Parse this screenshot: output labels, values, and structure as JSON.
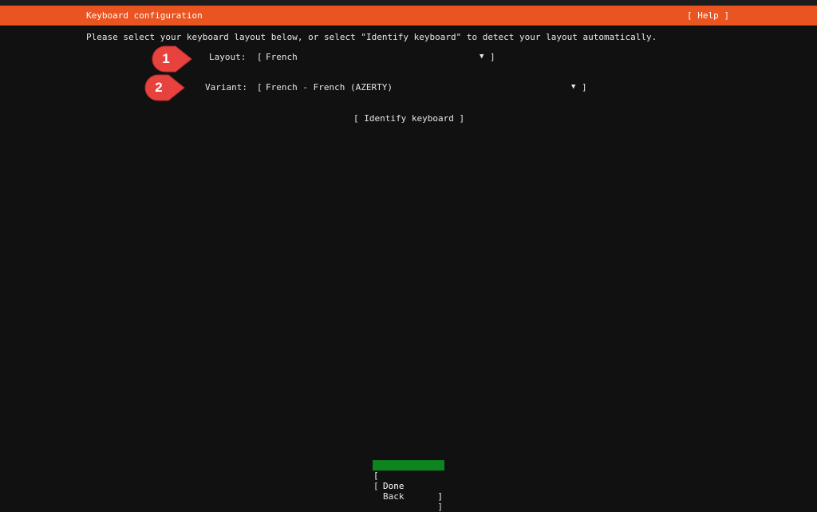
{
  "header": {
    "title": "Keyboard configuration",
    "help_label": "[ Help ]"
  },
  "instruction": "Please select your keyboard layout below, or select \"Identify keyboard\" to detect your layout automatically.",
  "layout": {
    "label": "Layout:",
    "value": "French",
    "open_bracket": "[",
    "close_bracket": "]",
    "arrow": "▼"
  },
  "variant": {
    "label": "Variant:",
    "value": "French - French (AZERTY)",
    "open_bracket": "[",
    "close_bracket": "]",
    "arrow": "▼"
  },
  "identify_label": "[ Identify keyboard ]",
  "buttons": {
    "done": {
      "label": "Done",
      "open_bracket": "[",
      "close_bracket": "]"
    },
    "back": {
      "label": "Back",
      "open_bracket": "[",
      "close_bracket": "]"
    }
  },
  "callouts": [
    {
      "number": "1"
    },
    {
      "number": "2"
    }
  ],
  "colors": {
    "header": "#e95420",
    "background": "#111111",
    "done_button": "#0e8420",
    "callout": "#e8423f"
  }
}
